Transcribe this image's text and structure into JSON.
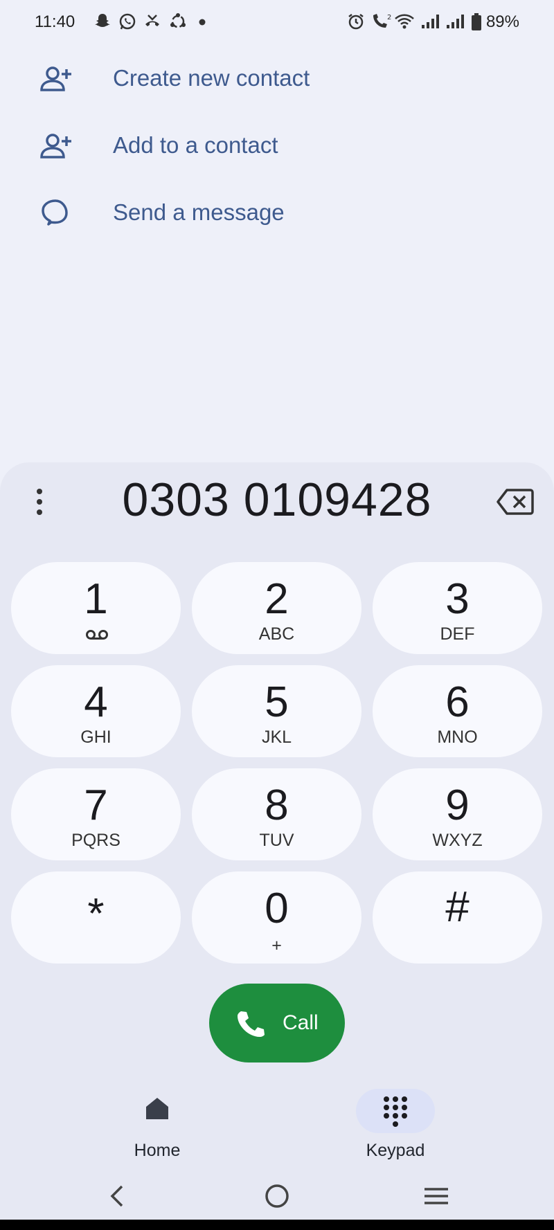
{
  "status_bar": {
    "time": "11:40",
    "battery_pct": "89%"
  },
  "actions": [
    {
      "label": "Create new contact",
      "icon": "person-add-icon"
    },
    {
      "label": "Add to a contact",
      "icon": "person-add-icon"
    },
    {
      "label": "Send a message",
      "icon": "message-icon"
    }
  ],
  "dialer": {
    "number": "0303 0109428"
  },
  "keys": [
    {
      "digit": "1",
      "letters": ""
    },
    {
      "digit": "2",
      "letters": "ABC"
    },
    {
      "digit": "3",
      "letters": "DEF"
    },
    {
      "digit": "4",
      "letters": "GHI"
    },
    {
      "digit": "5",
      "letters": "JKL"
    },
    {
      "digit": "6",
      "letters": "MNO"
    },
    {
      "digit": "7",
      "letters": "PQRS"
    },
    {
      "digit": "8",
      "letters": "TUV"
    },
    {
      "digit": "9",
      "letters": "WXYZ"
    },
    {
      "digit": "*",
      "letters": ""
    },
    {
      "digit": "0",
      "letters": "+"
    },
    {
      "digit": "#",
      "letters": ""
    }
  ],
  "call": {
    "label": "Call"
  },
  "nav": {
    "home": "Home",
    "keypad": "Keypad"
  },
  "colors": {
    "accent_text": "#3e5a8e",
    "call_green": "#1e8e3e",
    "background": "#eef0f9",
    "key_bg": "#f8f9fe"
  }
}
